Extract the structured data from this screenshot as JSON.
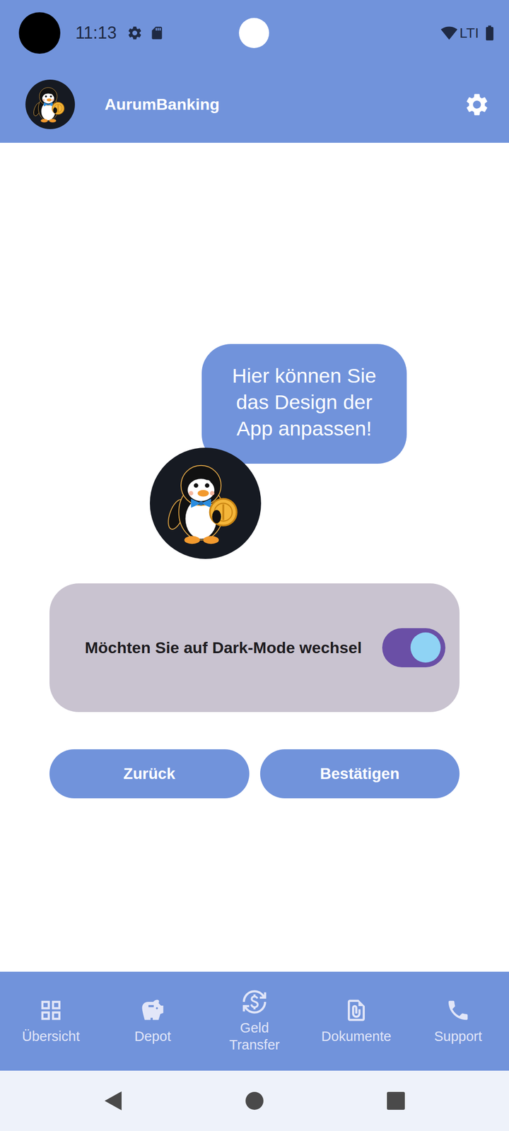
{
  "status_bar": {
    "time": "11:13",
    "network": "LTI"
  },
  "app_bar": {
    "title": "AurumBanking"
  },
  "bubble": {
    "text": "Hier können Sie das Design der App anpassen!"
  },
  "setting": {
    "label": "Möchten Sie auf Dark-Mode wechsel",
    "on": true
  },
  "buttons": [
    "Zurück",
    "Bestätigen"
  ],
  "nav": [
    {
      "label": "Übersicht",
      "selected": false
    },
    {
      "label": "Depot",
      "selected": false
    },
    {
      "label": "Geld Transfer",
      "selected": false
    },
    {
      "label": "Dokumente",
      "selected": false
    },
    {
      "label": "Support",
      "selected": false
    }
  ]
}
